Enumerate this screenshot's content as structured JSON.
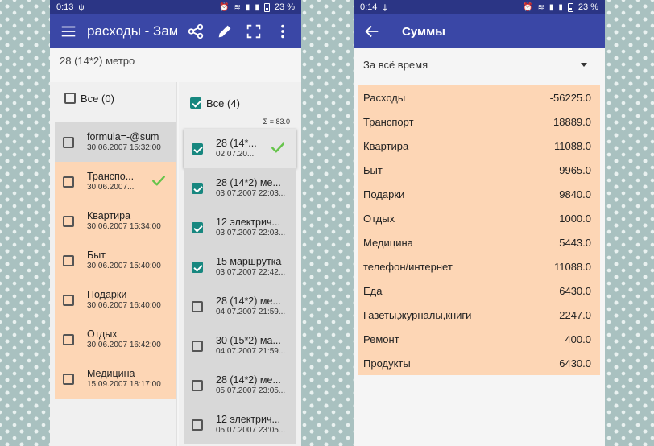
{
  "colors": {
    "primary": "#3a47a6",
    "status": "#2b3585",
    "accent_teal": "#17877f",
    "highlight_peach": "#fdd6b5",
    "grey_row": "#d8d8d8",
    "tick_green": "#66c44b"
  },
  "left": {
    "status": {
      "time": "0:13",
      "battery": "23 %"
    },
    "appbar": {
      "title": "расходы - Зам..."
    },
    "subtitle": "28 (14*2) метро",
    "col_a": {
      "all_label": "Все (0)",
      "items": [
        {
          "main": "formula=-@sum",
          "date": "30.06.2007 15:32:00",
          "checked": false,
          "tick": false,
          "bg": "grey"
        },
        {
          "main": "Транспо...",
          "date": "30.06.2007...",
          "checked": false,
          "tick": true,
          "bg": "peach"
        },
        {
          "main": "Квартира",
          "date": "30.06.2007 15:34:00",
          "checked": false,
          "tick": false,
          "bg": "peach"
        },
        {
          "main": "Быт",
          "date": "30.06.2007 15:40:00",
          "checked": false,
          "tick": false,
          "bg": "peach"
        },
        {
          "main": "Подарки",
          "date": "30.06.2007 16:40:00",
          "checked": false,
          "tick": false,
          "bg": "peach"
        },
        {
          "main": "Отдых",
          "date": "30.06.2007 16:42:00",
          "checked": false,
          "tick": false,
          "bg": "peach"
        },
        {
          "main": "Медицина",
          "date": "15.09.2007 18:17:00",
          "checked": false,
          "tick": false,
          "bg": "peach"
        }
      ]
    },
    "col_b": {
      "all_label": "Все (4)",
      "sum_label": "Σ = 83.0",
      "items": [
        {
          "main": "28 (14*...",
          "date": "02.07.20...",
          "checked": true,
          "tick": true,
          "bg": "selected"
        },
        {
          "main": "28 (14*2) ме...",
          "date": "03.07.2007 22:03...",
          "checked": true,
          "tick": false,
          "bg": "grey"
        },
        {
          "main": "12 электрич...",
          "date": "03.07.2007 22:03...",
          "checked": true,
          "tick": false,
          "bg": "grey"
        },
        {
          "main": "15 маршрутка",
          "date": "03.07.2007 22:42...",
          "checked": true,
          "tick": false,
          "bg": "grey"
        },
        {
          "main": "28 (14*2) ме...",
          "date": "04.07.2007 21:59...",
          "checked": false,
          "tick": false,
          "bg": "grey"
        },
        {
          "main": "30 (15*2) ма...",
          "date": "04.07.2007 21:59...",
          "checked": false,
          "tick": false,
          "bg": "grey"
        },
        {
          "main": "28 (14*2) ме...",
          "date": "05.07.2007 23:05...",
          "checked": false,
          "tick": false,
          "bg": "grey"
        },
        {
          "main": "12 электрич...",
          "date": "05.07.2007 23:05...",
          "checked": false,
          "tick": false,
          "bg": "grey"
        }
      ]
    }
  },
  "right": {
    "status": {
      "time": "0:14",
      "battery": "23 %"
    },
    "toolbar": {
      "title": "Суммы"
    },
    "dropdown": {
      "selected": "За всё время"
    },
    "sums": [
      {
        "label": "Расходы",
        "value": "-56225.0"
      },
      {
        "label": "Транспорт",
        "value": "18889.0"
      },
      {
        "label": "Квартира",
        "value": "11088.0"
      },
      {
        "label": "Быт",
        "value": "9965.0"
      },
      {
        "label": "Подарки",
        "value": "9840.0"
      },
      {
        "label": "Отдых",
        "value": "1000.0"
      },
      {
        "label": "Медицина",
        "value": "5443.0"
      },
      {
        "label": "телефон/интернет",
        "value": "11088.0"
      },
      {
        "label": "Еда",
        "value": "6430.0"
      },
      {
        "label": "Газеты,журналы,книги",
        "value": "2247.0"
      },
      {
        "label": "Ремонт",
        "value": "400.0"
      },
      {
        "label": "Продукты",
        "value": "6430.0"
      }
    ]
  }
}
